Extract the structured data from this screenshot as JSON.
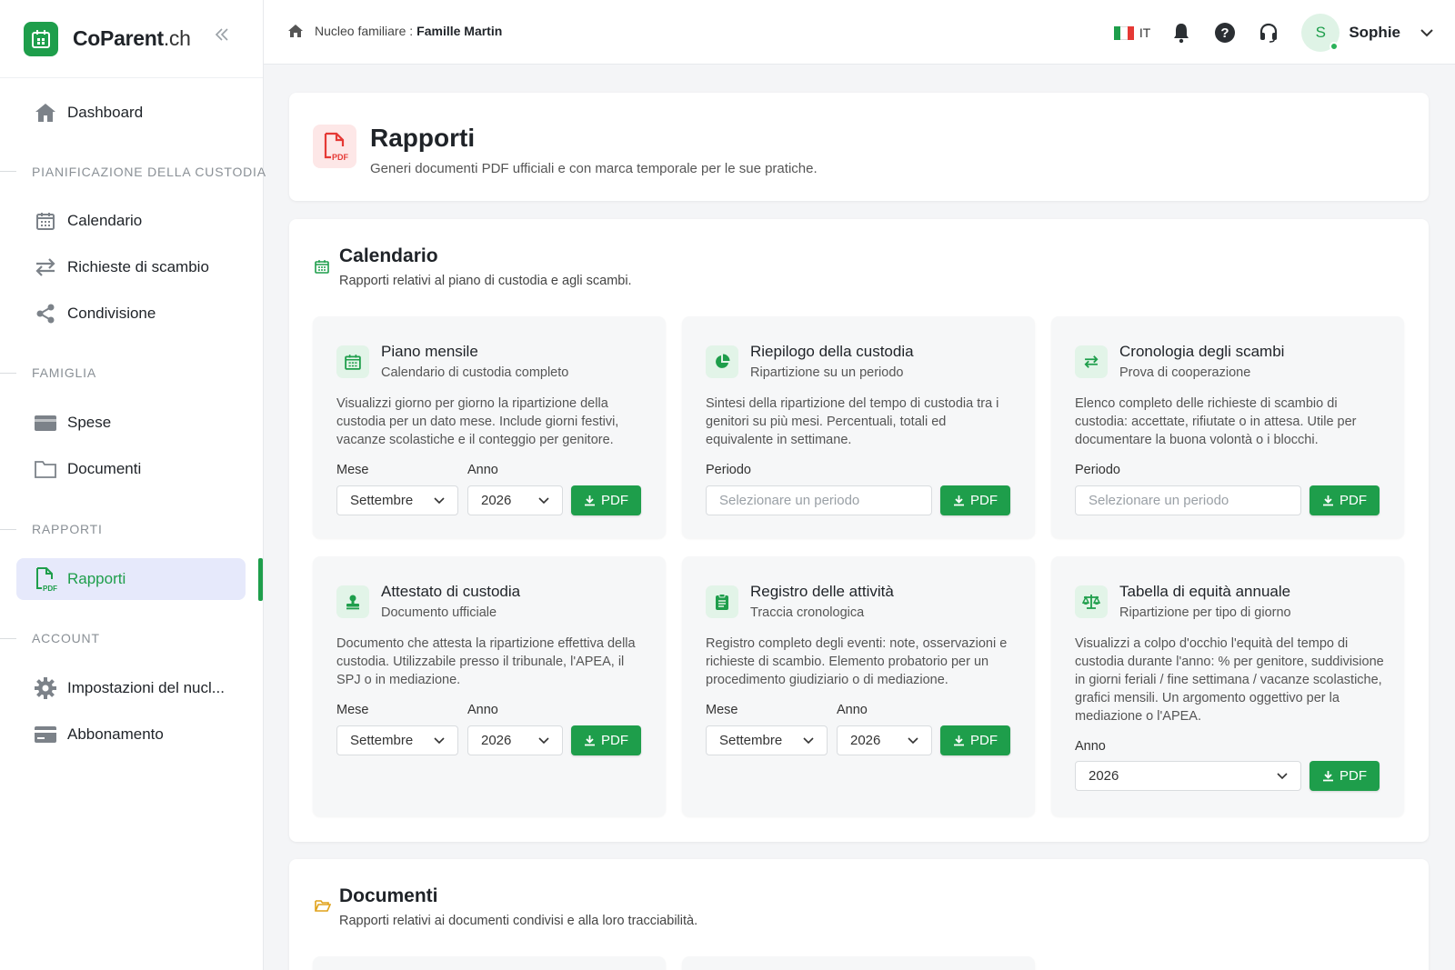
{
  "app": {
    "brand_main": "CoParent",
    "brand_tld": ".ch"
  },
  "topbar": {
    "breadcrumb_label": "Nucleo familiare :",
    "breadcrumb_value": "Famille Martin",
    "language": "IT",
    "user_initial": "S",
    "user_name": "Sophie"
  },
  "sidebar": {
    "dashboard": "Dashboard",
    "sections": {
      "planning": "PIANIFICAZIONE DELLA CUSTODIA",
      "family": "FAMIGLIA",
      "reports": "RAPPORTI",
      "account": "ACCOUNT"
    },
    "items": {
      "calendar": "Calendario",
      "swap_requests": "Richieste di scambio",
      "sharing": "Condivisione",
      "expenses": "Spese",
      "documents": "Documenti",
      "reports": "Rapporti",
      "settings": "Impostazioni del nucl...",
      "subscription": "Abbonamento"
    }
  },
  "page": {
    "title": "Rapporti",
    "subtitle": "Generi documenti PDF ufficiali e con marca temporale per le sue pratiche."
  },
  "calendar_section": {
    "title": "Calendario",
    "subtitle": "Rapporti relativi al piano di custodia e agli scambi.",
    "cards": [
      {
        "title": "Piano mensile",
        "subtitle": "Calendario di custodia completo",
        "description": "Visualizzi giorno per giorno la ripartizione della custodia per un dato mese. Include giorni festivi, vacanze scolastiche e il conteggio per genitore.",
        "month_label": "Mese",
        "month_value": "Settembre",
        "year_label": "Anno",
        "year_value": "2026",
        "button": "PDF"
      },
      {
        "title": "Riepilogo della custodia",
        "subtitle": "Ripartizione su un periodo",
        "description": "Sintesi della ripartizione del tempo di custodia tra i genitori su più mesi. Percentuali, totali ed equivalente in settimane.",
        "period_label": "Periodo",
        "period_placeholder": "Selezionare un periodo",
        "button": "PDF"
      },
      {
        "title": "Cronologia degli scambi",
        "subtitle": "Prova di cooperazione",
        "description": "Elenco completo delle richieste di scambio di custodia: accettate, rifiutate o in attesa. Utile per documentare la buona volontà o i blocchi.",
        "period_label": "Periodo",
        "period_placeholder": "Selezionare un periodo",
        "button": "PDF"
      },
      {
        "title": "Attestato di custodia",
        "subtitle": "Documento ufficiale",
        "description": "Documento che attesta la ripartizione effettiva della custodia. Utilizzabile presso il tribunale, l'APEA, il SPJ o in mediazione.",
        "month_label": "Mese",
        "month_value": "Settembre",
        "year_label": "Anno",
        "year_value": "2026",
        "button": "PDF"
      },
      {
        "title": "Registro delle attività",
        "subtitle": "Traccia cronologica",
        "description": "Registro completo degli eventi: note, osservazioni e richieste di scambio. Elemento probatorio per un procedimento giudiziario o di mediazione.",
        "month_label": "Mese",
        "month_value": "Settembre",
        "year_label": "Anno",
        "year_value": "2026",
        "button": "PDF"
      },
      {
        "title": "Tabella di equità annuale",
        "subtitle": "Ripartizione per tipo di giorno",
        "description": "Visualizzi a colpo d'occhio l'equità del tempo di custodia durante l'anno: % per genitore, suddivisione in giorni feriali / fine settimana / vacanze scolastiche, grafici mensili. Un argomento oggettivo per la mediazione o l'APEA.",
        "year_label": "Anno",
        "year_value": "2026",
        "button": "PDF"
      }
    ]
  },
  "documents_section": {
    "title": "Documenti",
    "subtitle": "Rapporti relativi ai documenti condivisi e alla loro tracciabilità."
  },
  "colors": {
    "accent": "#1e9e4b",
    "active_bg": "#e6e9fb",
    "pdf_red": "#e53935"
  }
}
